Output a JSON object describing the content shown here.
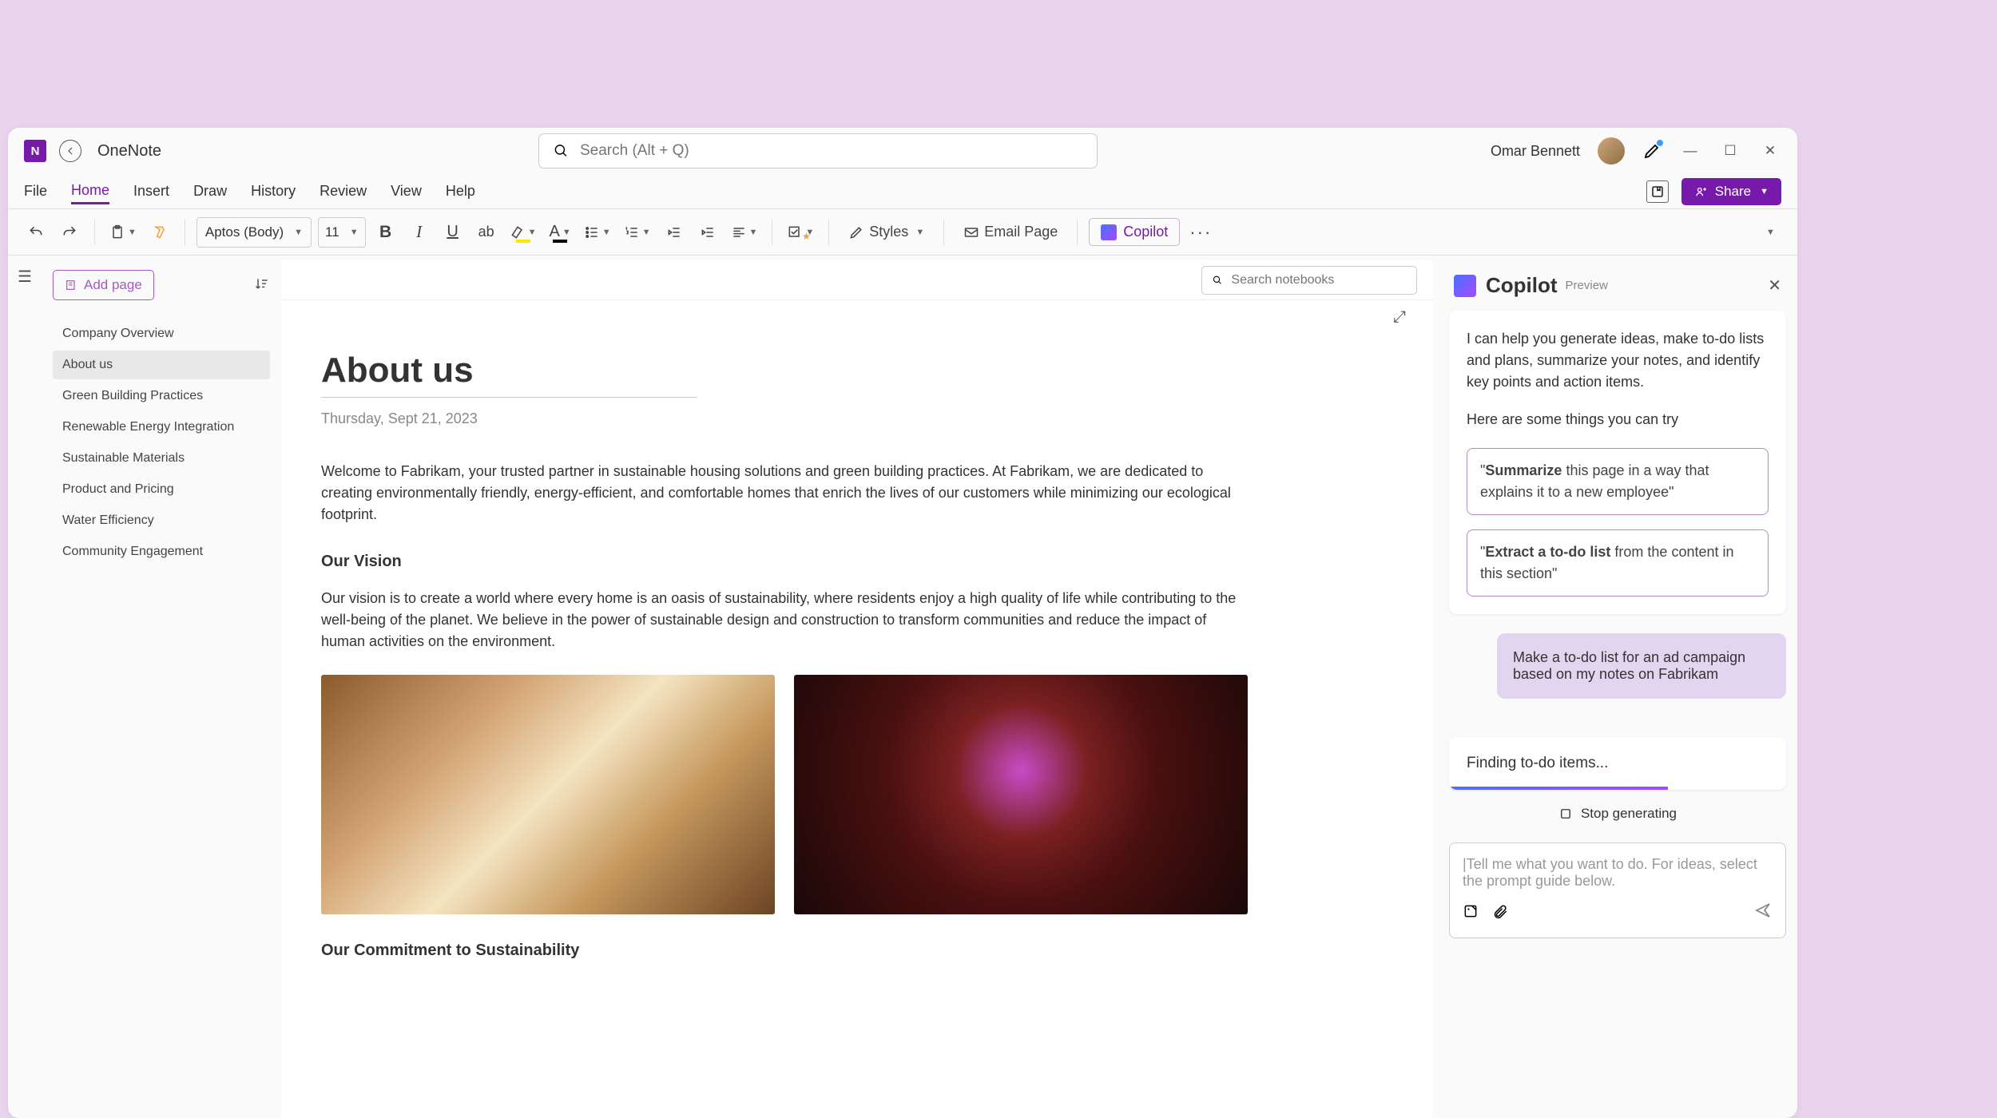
{
  "app": {
    "name": "OneNote"
  },
  "user": {
    "name": "Omar Bennett"
  },
  "search": {
    "placeholder": "Search (Alt + Q)"
  },
  "menu": {
    "items": [
      "File",
      "Home",
      "Insert",
      "Draw",
      "History",
      "Review",
      "View",
      "Help"
    ],
    "active": "Home",
    "share": "Share"
  },
  "ribbon": {
    "font": "Aptos (Body)",
    "size": "11",
    "styles": "Styles",
    "email": "Email Page",
    "copilot": "Copilot"
  },
  "nbsearch": {
    "placeholder": "Search notebooks"
  },
  "pagelist": {
    "add": "Add page",
    "items": [
      "Company Overview",
      "About us",
      "Green Building Practices",
      "Renewable Energy Integration",
      "Sustainable Materials",
      "Product and Pricing",
      "Water Efficiency",
      "Community Engagement"
    ],
    "selected": 1
  },
  "doc": {
    "title": "About us",
    "date": "Thursday, Sept 21, 2023",
    "intro": "Welcome to Fabrikam, your trusted partner in sustainable housing solutions and green building practices. At Fabrikam, we are dedicated to creating environmentally friendly, energy-efficient, and comfortable homes that enrich the lives of our customers while minimizing our ecological footprint.",
    "h1": "Our Vision",
    "p1": "Our vision is to create a world where every home is an oasis of sustainability, where residents enjoy a high quality of life while contributing to the well-being of the planet. We believe in the power of sustainable design and construction to transform communities and reduce the impact of human activities on the environment.",
    "h2": "Our Commitment to Sustainability"
  },
  "copilot": {
    "title": "Copilot",
    "preview": "Preview",
    "intro": "I can help you generate ideas, make to-do lists and plans, summarize your notes, and identify key points and action items.",
    "try": "Here are some things you can try",
    "s1a": "Summarize",
    "s1b": " this page in a way that explains it to a new employee\"",
    "s2a": "Extract a to-do list",
    "s2b": " from the content in this section\"",
    "userMsg": "Make a to-do list for an ad campaign based on my notes on Fabrikam",
    "status": "Finding to-do items...",
    "stop": "Stop generating",
    "placeholder": "Tell me what you want to do. For ideas, select the prompt guide below."
  }
}
